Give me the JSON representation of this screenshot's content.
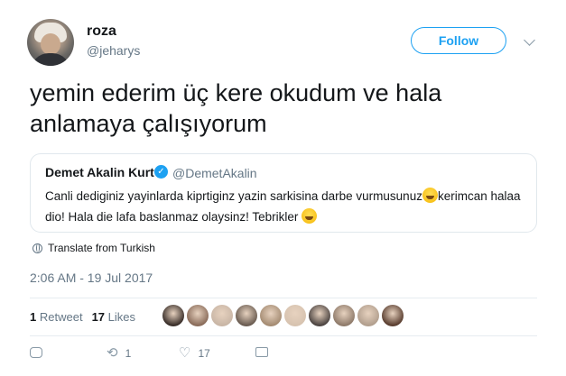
{
  "author": {
    "display_name": "roza",
    "handle": "@jeharys"
  },
  "follow_label": "Follow",
  "tweet_text": "yemin ederim üç kere okudum ve hala anlamaya çalışıyorum",
  "quoted": {
    "name": "Demet Akalin Kurt",
    "handle": "@DemetAkalin",
    "text_part1": "Canli dediginiz yayinlarda kiprtiginz yazin sarkisina darbe vurmusunuz",
    "text_part2": "kerimcan halaa dio! Hala die lafa baslanmaz olaysinz! Tebrikler "
  },
  "translate_label": "Translate from Turkish",
  "timestamp": "2:06 AM - 19 Jul 2017",
  "stats": {
    "retweets_count": "1",
    "retweets_label": "Retweet",
    "likes_count": "17",
    "likes_label": "Likes"
  },
  "liker_avatar_colors": [
    "#3a2f2a",
    "#8a6c5a",
    "#c9b6a6",
    "#6b5d52",
    "#a58c73",
    "#d7c3b0",
    "#4d4542",
    "#8f7b6b",
    "#b29f8e",
    "#5a3e30"
  ],
  "actions": {
    "retweet_count": "1",
    "like_count": "17"
  },
  "icons": {
    "reply": "reply-icon",
    "retweet": "retweet-icon",
    "like": "heart-icon",
    "dm": "mail-icon"
  },
  "colors": {
    "accent": "#1da1f2",
    "secondary_text": "#657786"
  }
}
